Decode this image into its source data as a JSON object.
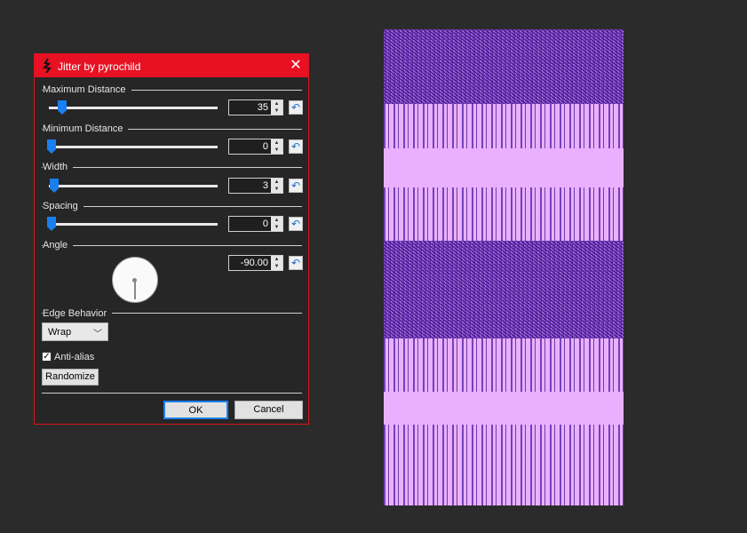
{
  "dialog": {
    "title": "Jitter by pyrochild",
    "close_glyph": "✕",
    "sections": {
      "max_distance": {
        "label": "Maximum Distance",
        "value": "35",
        "slider_fraction": 0.09
      },
      "min_distance": {
        "label": "Minimum Distance",
        "value": "0",
        "slider_fraction": 0.0
      },
      "width": {
        "label": "Width",
        "value": "3",
        "slider_fraction": 0.03
      },
      "spacing": {
        "label": "Spacing",
        "value": "0",
        "slider_fraction": 0.0
      },
      "angle": {
        "label": "Angle",
        "value": "-90.00"
      }
    },
    "reset_glyph": "↶",
    "edge_behavior": {
      "label": "Edge Behavior",
      "selected": "Wrap"
    },
    "antialias": {
      "label": "Anti-alias",
      "checked": true
    },
    "randomize_label": "Randomize",
    "ok_label": "OK",
    "cancel_label": "Cancel"
  },
  "colors": {
    "titlebar": "#e81123",
    "accent": "#1a7ff0",
    "canvas_bg": "#eab0ff",
    "noise_purple": "#6b2db8"
  }
}
